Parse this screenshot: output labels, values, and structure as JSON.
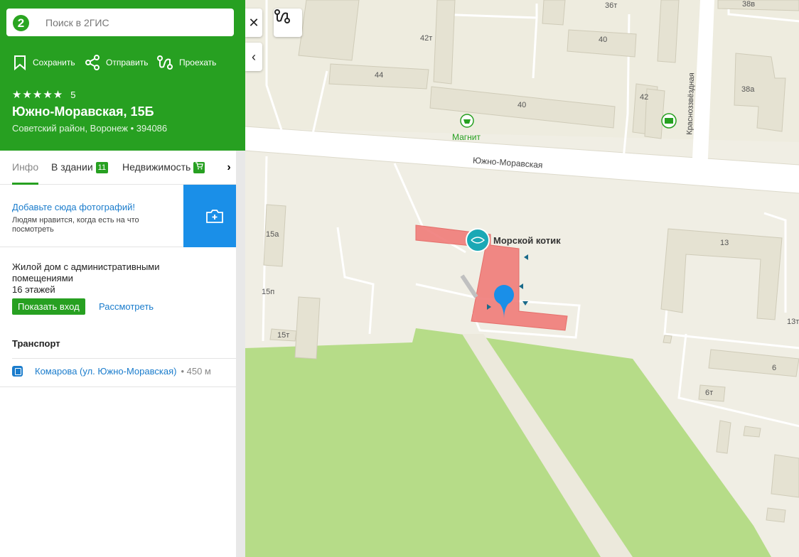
{
  "search": {
    "placeholder": "Поиск в 2ГИС",
    "logo": "2"
  },
  "actions": {
    "save": "Сохранить",
    "send": "Отправить",
    "route": "Проехать"
  },
  "place": {
    "stars": "★★★★★",
    "rating": "5",
    "title": "Южно-Моравская, 15Б",
    "address": "Советский район, Воронеж • 394086"
  },
  "tabs": [
    {
      "label": "Инфо"
    },
    {
      "label": "В здании",
      "badge": "11"
    },
    {
      "label": "Недвижимость"
    }
  ],
  "photo": {
    "title": "Добавьте сюда фотографий!",
    "subtitle": "Людям нравится, когда есть на что посмотреть"
  },
  "building": {
    "description": "Жилой дом с административными помещениями",
    "floors": "16 этажей",
    "show_entrance": "Показать вход",
    "view": "Рассмотреть"
  },
  "transport": {
    "title": "Транспорт",
    "stop": "Комарова (ул. Южно-Моравская)",
    "distance": "• 450 м"
  },
  "map": {
    "street_main": "Южно-Моравская",
    "street_side": "Красноззвёздная",
    "poi_magnit": "Магнит",
    "poi_kotik": "Морской котик",
    "buildings": {
      "b36t": "36т",
      "b38v": "38в",
      "b40a": "40",
      "b42t": "42т",
      "b44": "44",
      "b40b": "40",
      "b42": "42",
      "b38a": "38а",
      "b15a": "15а",
      "b15p": "15п",
      "b15t": "15т",
      "b13": "13",
      "b13t": "13т",
      "b6": "6",
      "b6t": "6т"
    }
  }
}
